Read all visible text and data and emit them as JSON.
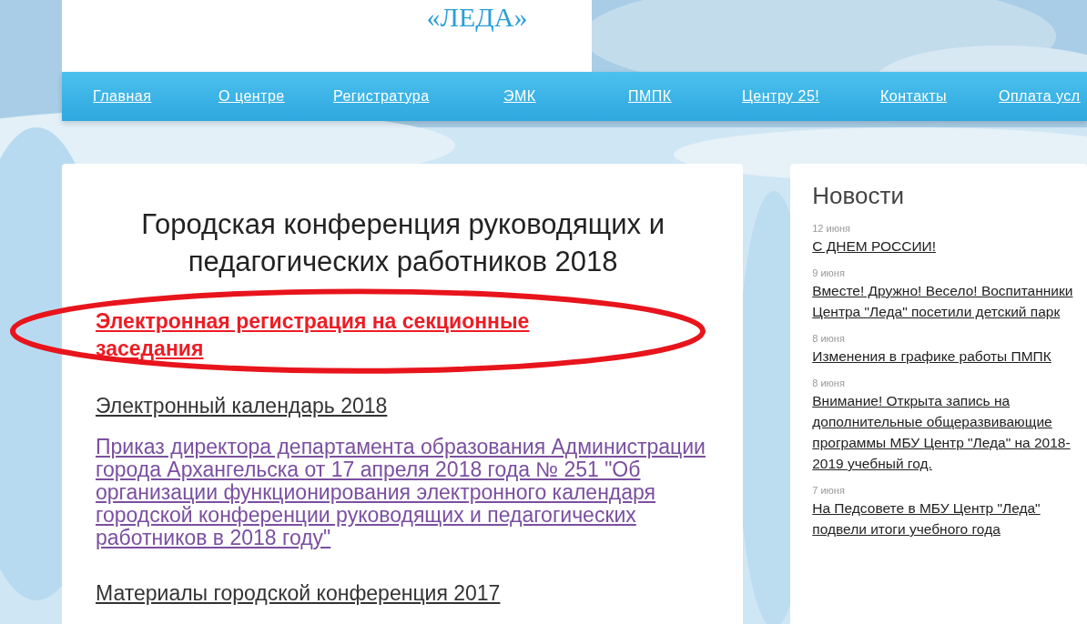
{
  "header": {
    "logo_text": "«ЛЕДА»"
  },
  "nav": [
    {
      "label": "Главная"
    },
    {
      "label": "О центре"
    },
    {
      "label": "Регистратура"
    },
    {
      "label": "ЭМК"
    },
    {
      "label": "ПМПК"
    },
    {
      "label": "Центру 25!"
    },
    {
      "label": "Контакты"
    },
    {
      "label": "Оплата усл"
    }
  ],
  "main": {
    "title": "Городская конференция руководящих и педагогических работников 2018",
    "links": [
      {
        "kind": "highlight",
        "text": "Электронная регистрация на секционные заседания"
      },
      {
        "kind": "plain",
        "text": "Электронный календарь 2018"
      },
      {
        "kind": "visited",
        "text": "Приказ директора департамента образования Администрации города Архангельска от 17 апреля 2018 года № 251 \"Об организации функционирования электронного календаря городской конференции руководящих и педагогических работников в 2018 году\""
      },
      {
        "kind": "plain",
        "text": "Материалы городской конференция 2017"
      }
    ]
  },
  "news": {
    "title": "Новости",
    "items": [
      {
        "date": "12 июня",
        "text": "С ДНЕМ РОССИИ!"
      },
      {
        "date": "9 июня",
        "text": "Вместе! Дружно! Весело! Воспитанники Центра \"Леда\" посетили детский парк"
      },
      {
        "date": "8 июня",
        "text": "Изменения в графике работы ПМПК"
      },
      {
        "date": "8 июня",
        "text": "Внимание! Открыта запись на дополнительные общеразвивающие программы МБУ Центр \"Леда\" на 2018-2019 учебный год."
      },
      {
        "date": "7 июня",
        "text": "На Педсовете в МБУ Центр \"Леда\" подвели итоги учебного года"
      }
    ]
  }
}
